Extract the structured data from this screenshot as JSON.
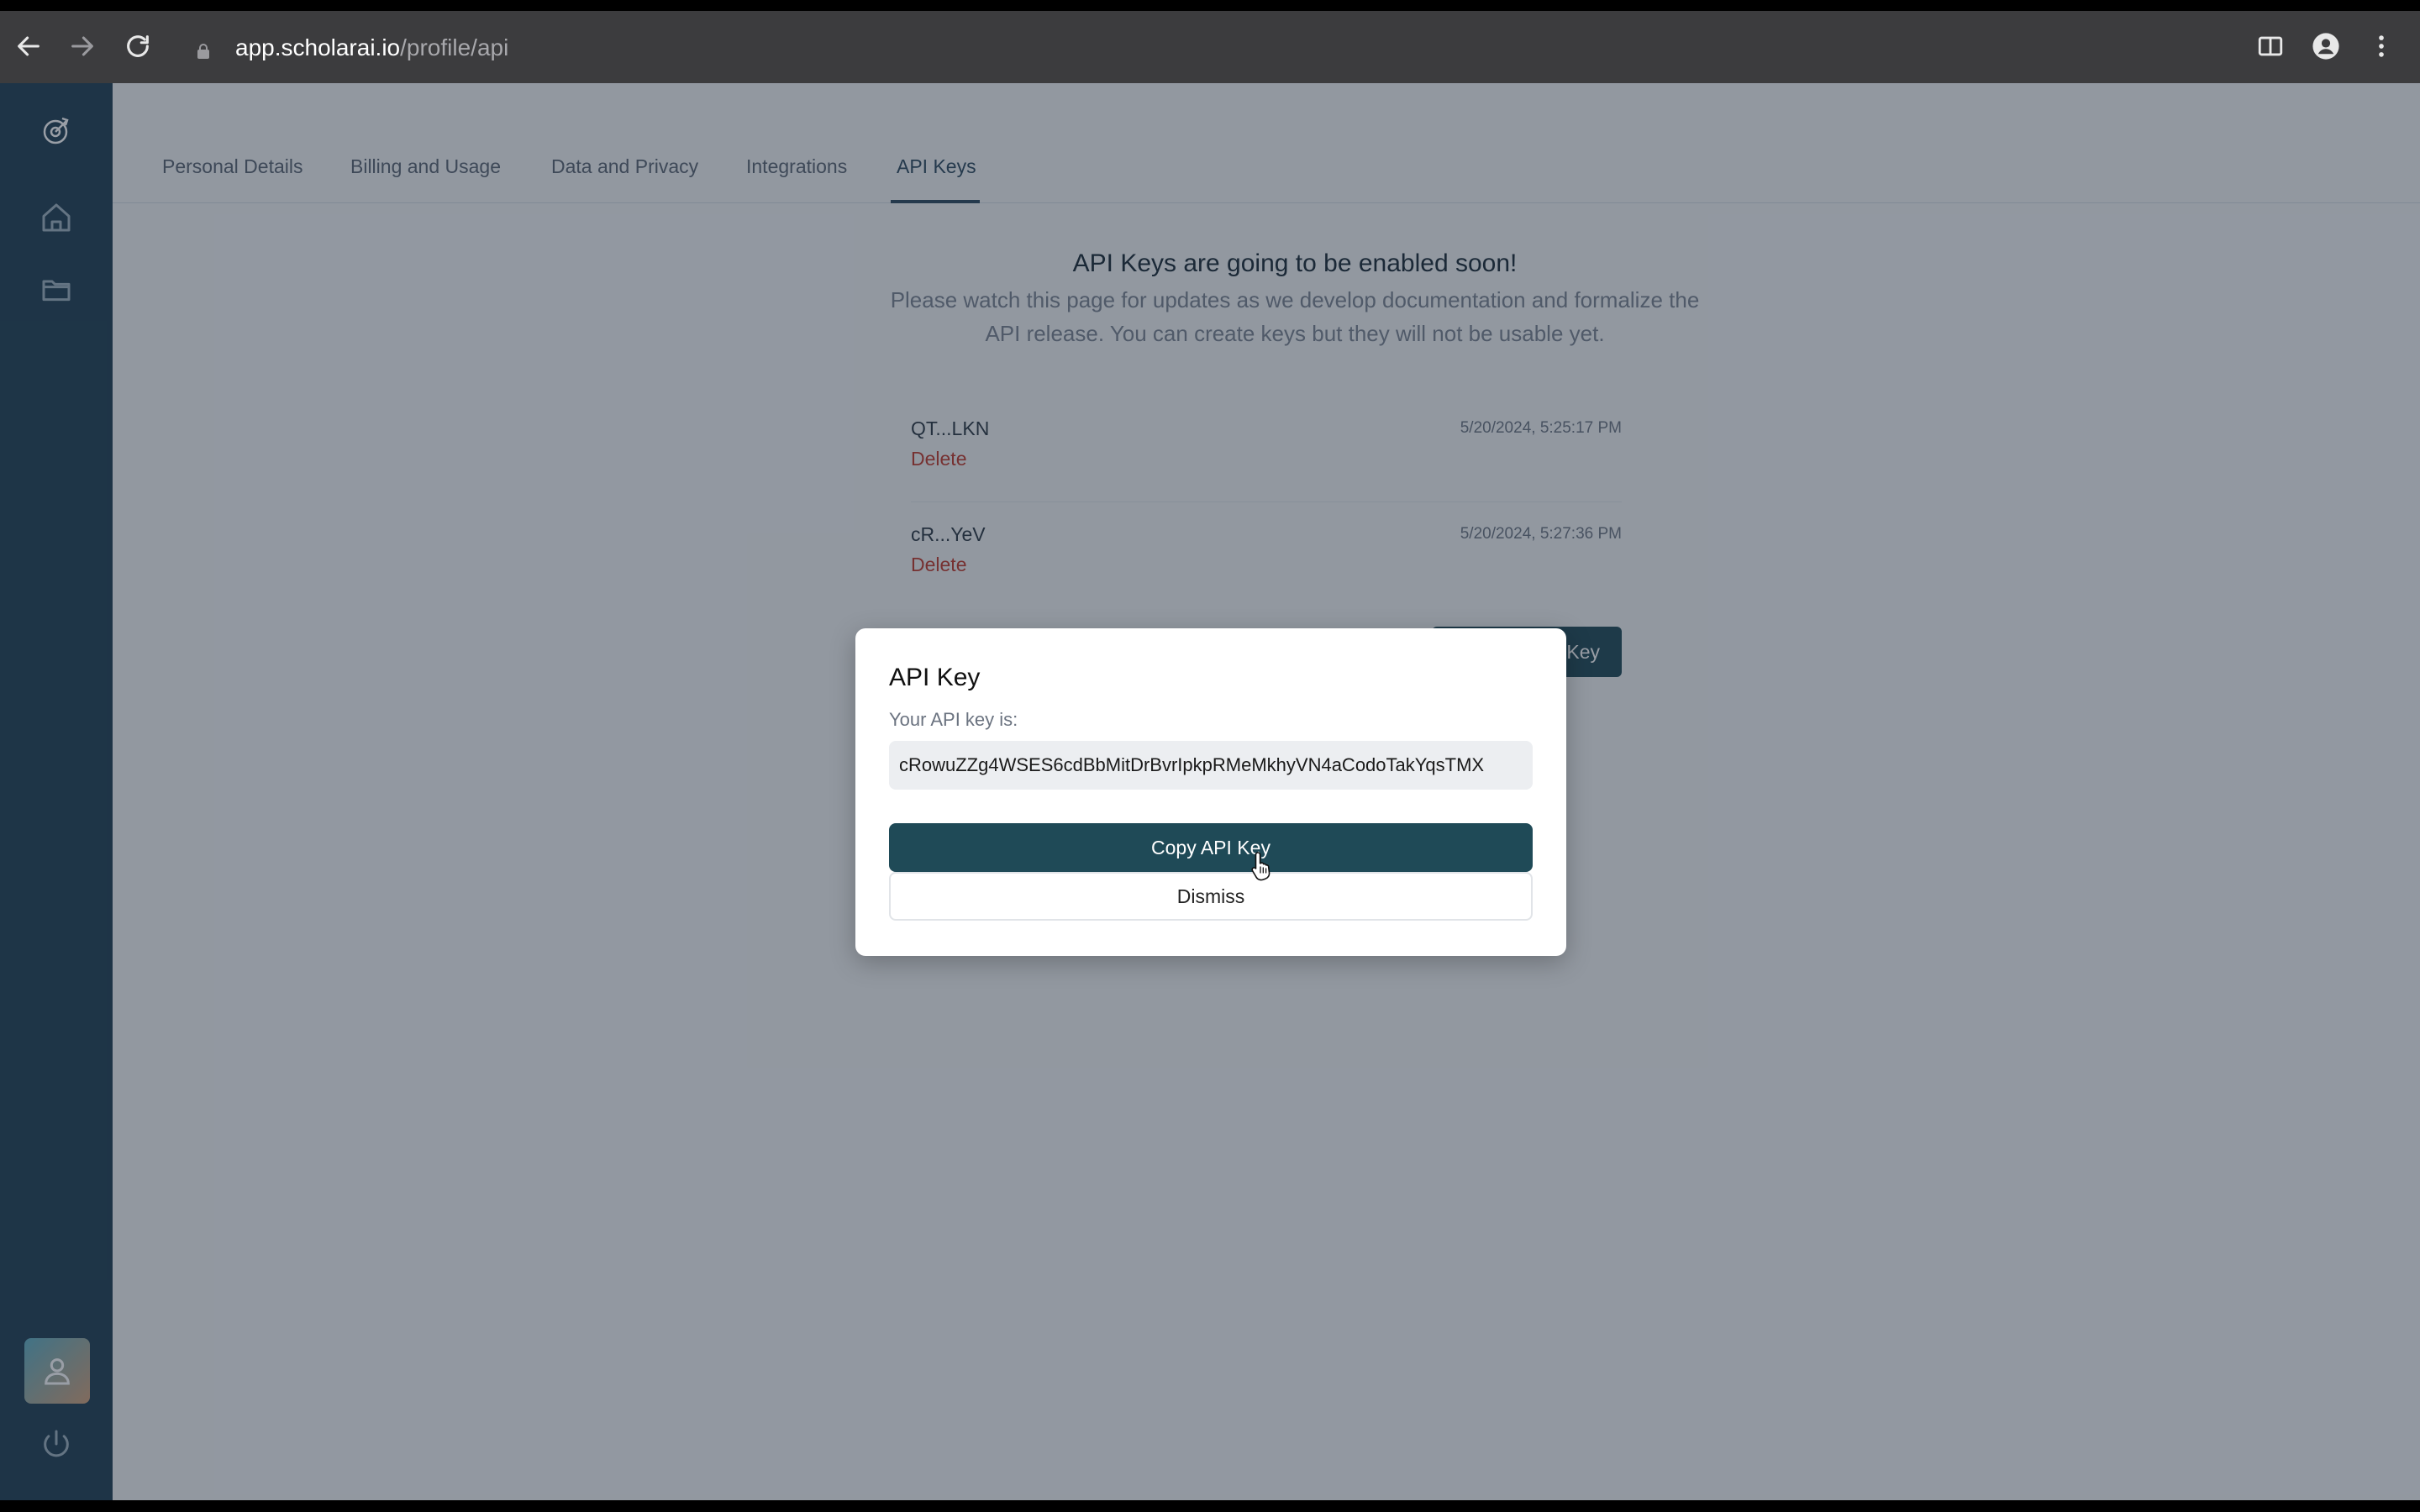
{
  "browser": {
    "url_host": "app.scholarai.io",
    "url_path": "/profile/api",
    "icons": [
      "back-icon",
      "forward-icon",
      "reload-icon",
      "lock-icon",
      "reading-mode-icon",
      "profile-icon",
      "menu-dots-icon"
    ]
  },
  "sidebar": {
    "icons": [
      "logo-icon",
      "home-icon",
      "folder-icon",
      "user-icon",
      "power-icon"
    ],
    "avatar_gradient": [
      "#5fb0c4",
      "#d4a27a"
    ]
  },
  "tabs": [
    {
      "label": "Personal Details"
    },
    {
      "label": "Billing and Usage"
    },
    {
      "label": "Data and Privacy"
    },
    {
      "label": "Integrations"
    },
    {
      "label": "API Keys"
    }
  ],
  "notice": {
    "title": "API Keys are going to be enabled soon!",
    "body": "Please watch this page for updates as we develop documentation and formalize the API release. You can create keys but they will not be usable yet."
  },
  "keys": [
    {
      "name": "QT...LKN",
      "delete_label": "Delete",
      "date": "5/20/2024, 5:25:17 PM"
    },
    {
      "name": "cR...YeV",
      "delete_label": "Delete",
      "date": "5/20/2024, 5:27:36 PM"
    }
  ],
  "create_button_label": "Key",
  "modal": {
    "title": "API Key",
    "label": "Your API key is:",
    "key_value": "cRowuZZg4WSES6cdBbMitDrBvrIpkpRMeMkhyVN4aCodoTakYqsTMX",
    "copy_label": "Copy API Key",
    "dismiss_label": "Dismiss"
  },
  "colors": {
    "sidebar": "#1f3f52",
    "primary_button": "#1f4a57",
    "delete": "#c0392b",
    "overlay": "rgba(28,40,58,0.45)"
  }
}
